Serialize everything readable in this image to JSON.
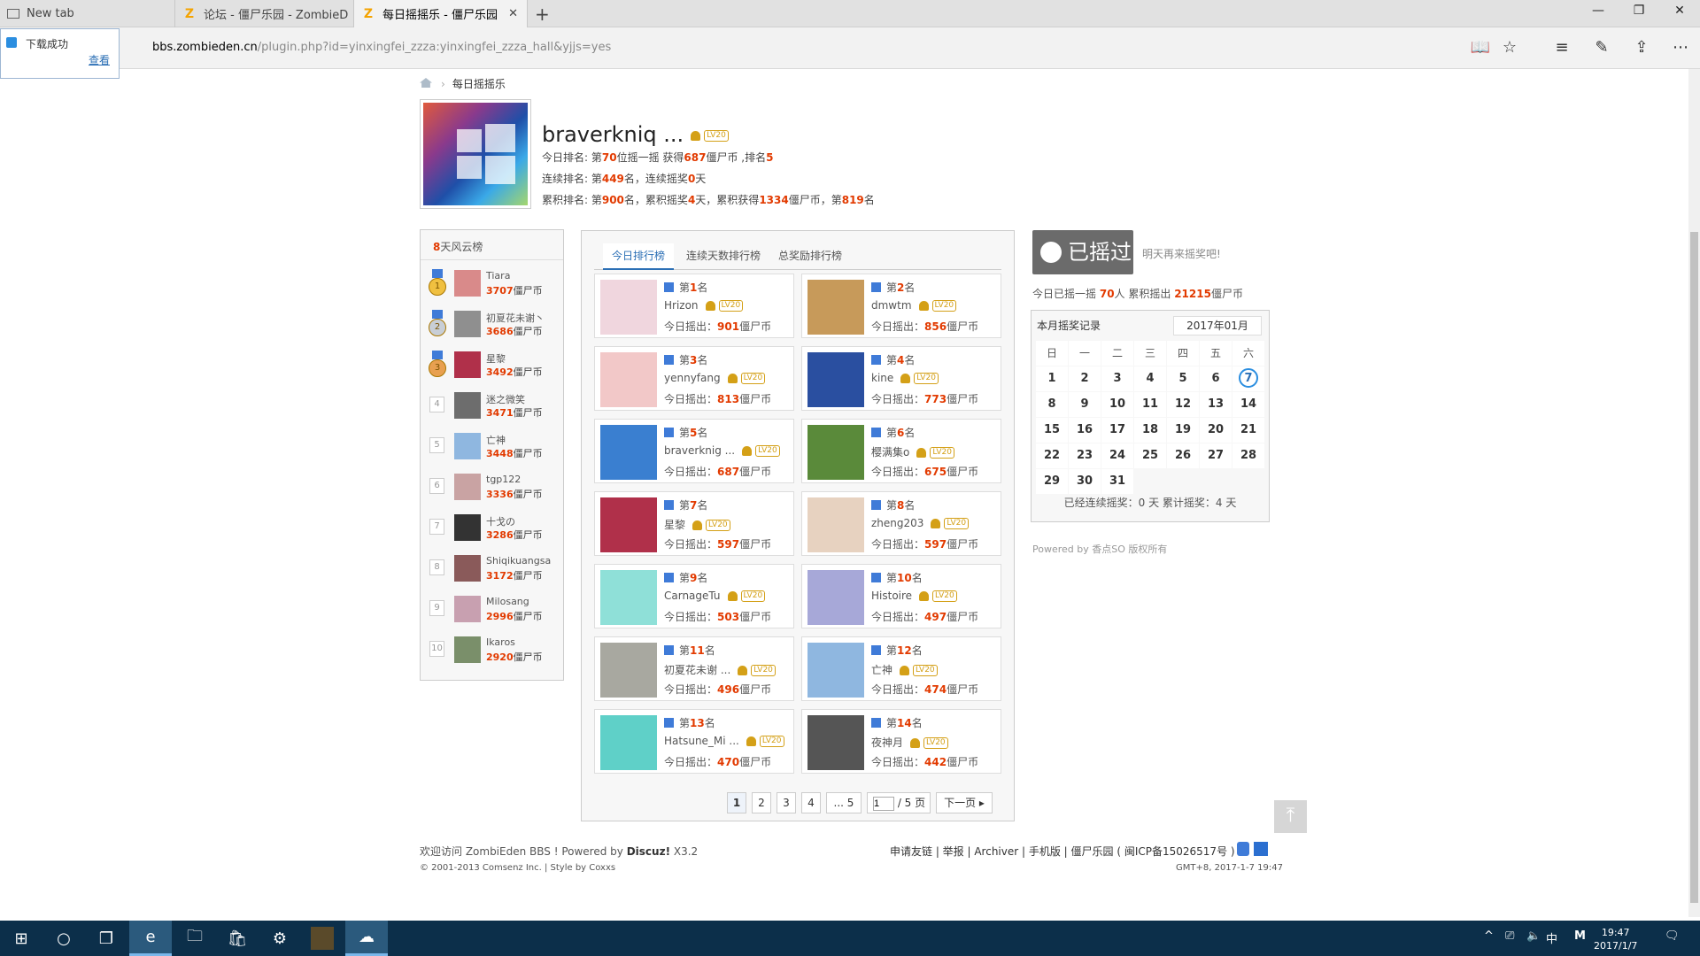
{
  "browser": {
    "tabs": [
      {
        "label": "New tab"
      },
      {
        "label": "论坛 - 僵尸乐园 - ZombieD"
      },
      {
        "label": "每日摇摇乐 - 僵尸乐园"
      }
    ],
    "url_domain": "bbs.zombieden.cn",
    "url_path": "/plugin.php?id=yinxingfei_zzza:yinxingfei_zzza_hall&yjjs=yes",
    "download_popup": {
      "text": "下载成功",
      "link": "查看"
    }
  },
  "breadcrumb": {
    "current": "每日摇摇乐"
  },
  "profile": {
    "username": "braverkniq ...",
    "level": "LV20",
    "line1_pre": "今日排名: 第",
    "line1_rank": "70",
    "line1_mid": "位摇一摇 获得",
    "line1_coins": "687",
    "line1_mid2": "僵尸币 ,排名",
    "line1_pos": "5",
    "line2_pre": "连续排名: 第",
    "line2_rank": "449",
    "line2_mid": "名，连续摇奖",
    "line2_days": "0",
    "line2_end": "天",
    "line3_pre": "累积排名: 第",
    "line3_rank": "900",
    "line3_mid": "名，累积摇奖",
    "line3_days": "4",
    "line3_mid2": "天，累积获得",
    "line3_coins": "1334",
    "line3_mid3": "僵尸币，第",
    "line3_pos": "819",
    "line3_end": "名"
  },
  "left_panel": {
    "title_num": "8",
    "title_text": "天风云榜",
    "coin_unit": "僵尸币",
    "rows": [
      {
        "rank": "1",
        "name": "Tiara",
        "coins": "3707",
        "color": "#d98a8a"
      },
      {
        "rank": "2",
        "name": "初夏花未谢丶",
        "coins": "3686",
        "color": "#8f8f8f"
      },
      {
        "rank": "3",
        "name": "星黎",
        "coins": "3492",
        "color": "#b0304a"
      },
      {
        "rank": "4",
        "name": "迷之微笑",
        "coins": "3471",
        "color": "#6d6d6d"
      },
      {
        "rank": "5",
        "name": "亡神",
        "coins": "3448",
        "color": "#8fb7e0"
      },
      {
        "rank": "6",
        "name": "tgp122",
        "coins": "3336",
        "color": "#c9a3a3"
      },
      {
        "rank": "7",
        "name": "十戈の",
        "coins": "3286",
        "color": "#333333"
      },
      {
        "rank": "8",
        "name": "Shiqikuangsa",
        "coins": "3172",
        "color": "#8a5a5a"
      },
      {
        "rank": "9",
        "name": "Milosang",
        "coins": "2996",
        "color": "#c8a0b0"
      },
      {
        "rank": "10",
        "name": "Ikaros",
        "coins": "2920",
        "color": "#7a8f6a"
      }
    ]
  },
  "center": {
    "tabs": [
      "今日排行榜",
      "连续天数排行榜",
      "总奖励排行榜"
    ],
    "rank_prefix": "第",
    "rank_suffix": "名",
    "shake_prefix": "今日摇出：",
    "coin_unit": "僵尸币",
    "cards": [
      {
        "rank": "1",
        "name": "Hrizon",
        "coins": "901",
        "color": "#f0d6de"
      },
      {
        "rank": "2",
        "name": "dmwtm",
        "coins": "856",
        "color": "#c79a5a"
      },
      {
        "rank": "3",
        "name": "yennyfang",
        "coins": "813",
        "color": "#f2c8c8"
      },
      {
        "rank": "4",
        "name": "kine",
        "coins": "773",
        "color": "#2a4fa0"
      },
      {
        "rank": "5",
        "name": "braverknig ...",
        "coins": "687",
        "color": "#3a7fd0"
      },
      {
        "rank": "6",
        "name": "樱满集o",
        "coins": "675",
        "color": "#5a8a3a"
      },
      {
        "rank": "7",
        "name": "星黎",
        "coins": "597",
        "color": "#b0304a"
      },
      {
        "rank": "8",
        "name": "zheng203",
        "coins": "597",
        "color": "#e7d2c0"
      },
      {
        "rank": "9",
        "name": "CarnageTu",
        "coins": "503",
        "color": "#8fe0d8"
      },
      {
        "rank": "10",
        "name": "Histoire",
        "coins": "497",
        "color": "#a7a8d8"
      },
      {
        "rank": "11",
        "name": "初夏花未谢 ...",
        "coins": "496",
        "color": "#a8a8a0"
      },
      {
        "rank": "12",
        "name": "亡神",
        "coins": "474",
        "color": "#8fb7e0"
      },
      {
        "rank": "13",
        "name": "Hatsune_Mi ...",
        "coins": "470",
        "color": "#5fd0c8"
      },
      {
        "rank": "14",
        "name": "夜神月",
        "coins": "442",
        "color": "#555555"
      }
    ],
    "pager": {
      "p1": "1",
      "p2": "2",
      "p3": "3",
      "p4": "4",
      "more": "... 5",
      "input": "1",
      "total": "/ 5 页",
      "next": "下一页"
    }
  },
  "right": {
    "shake_button": "已摇过",
    "tomorrow": "明天再来摇奖吧!",
    "today_pre": "今日已摇一摇",
    "today_people": "70",
    "today_mid": "人 累积摇出",
    "today_coins": "21215",
    "today_end": "僵尸币",
    "calendar": {
      "title": "本月摇奖记录",
      "month": "2017年01月",
      "weekdays": [
        "日",
        "一",
        "二",
        "三",
        "四",
        "五",
        "六"
      ],
      "today": "7",
      "footer": "已经连续摇奖：0 天 累计摇奖：4 天"
    },
    "powered": "Powered by 香点SO 版权所有"
  },
  "footer": {
    "welcome": "欢迎访问 ZombiEden BBS ! Powered by",
    "brand": "Discuz!",
    "version": "X3.2",
    "copyright": "© 2001-2013 Comsenz Inc. | Style by Coxxs",
    "links": "申请友链 | 举报 | Archiver | 手机版 | 僵尸乐园 ( 闽ICP备15026517号 )",
    "time": "GMT+8, 2017-1-7 19:47"
  },
  "taskbar": {
    "time": "19:47",
    "date": "2017/1/7",
    "ime": "中",
    "ime2": "M"
  }
}
